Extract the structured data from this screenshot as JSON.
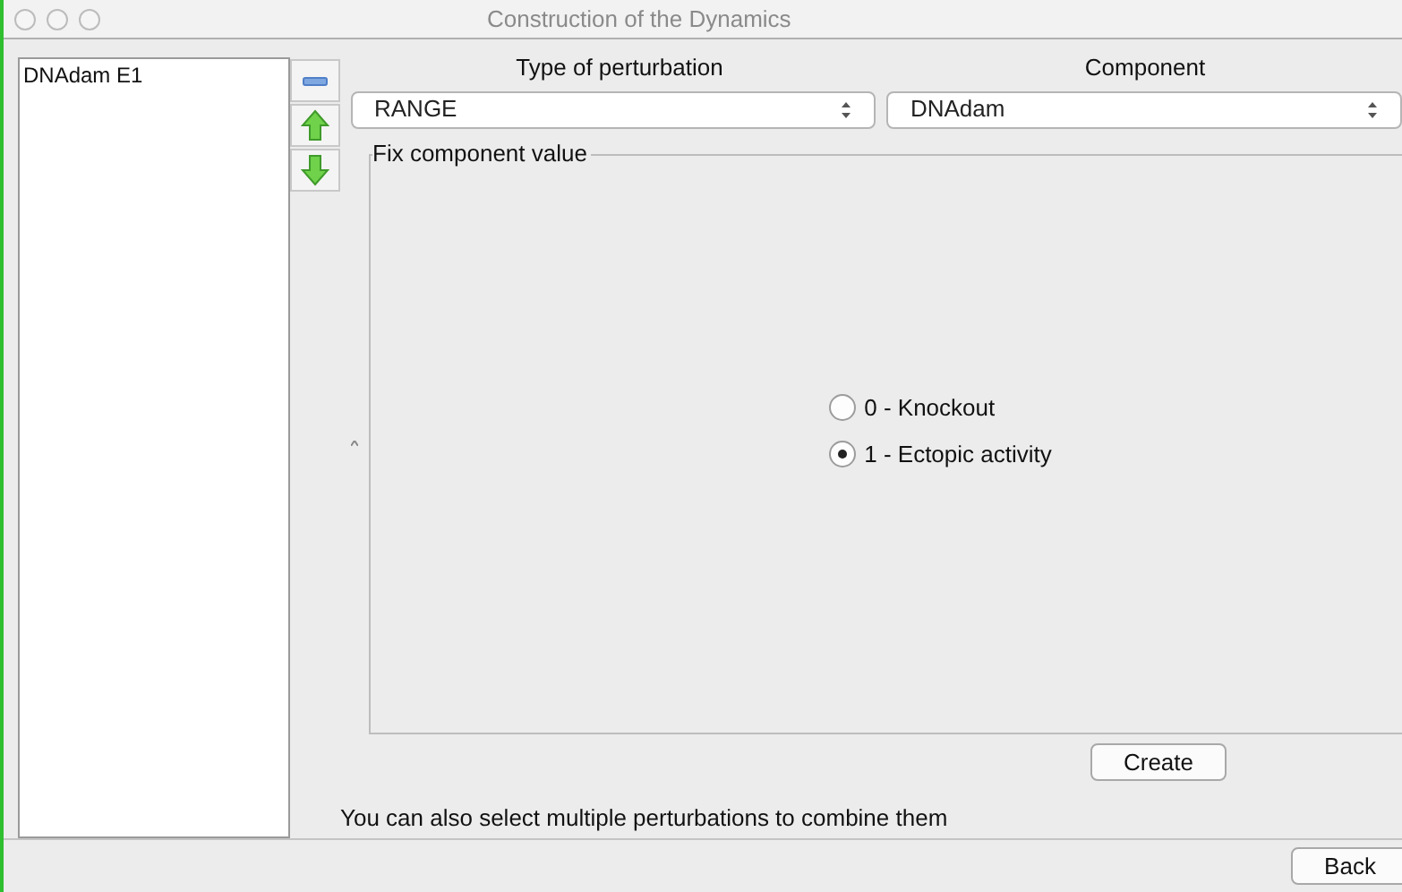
{
  "window": {
    "title": "Construction of the Dynamics"
  },
  "perturbation_list": {
    "items": [
      {
        "label": "DNAdam E1",
        "selected": false
      }
    ]
  },
  "type_of_perturbation": {
    "label": "Type of perturbation",
    "value": "RANGE"
  },
  "component": {
    "label": "Component",
    "value": "DNAdam"
  },
  "fix_component_value": {
    "title": "Fix component value",
    "options": [
      {
        "label": "0 - Knockout",
        "selected": false
      },
      {
        "label": "1 - Ectopic activity",
        "selected": true
      }
    ]
  },
  "create_button": "Create",
  "hint": "You can also select multiple perturbations to combine them",
  "back_button": "Back"
}
